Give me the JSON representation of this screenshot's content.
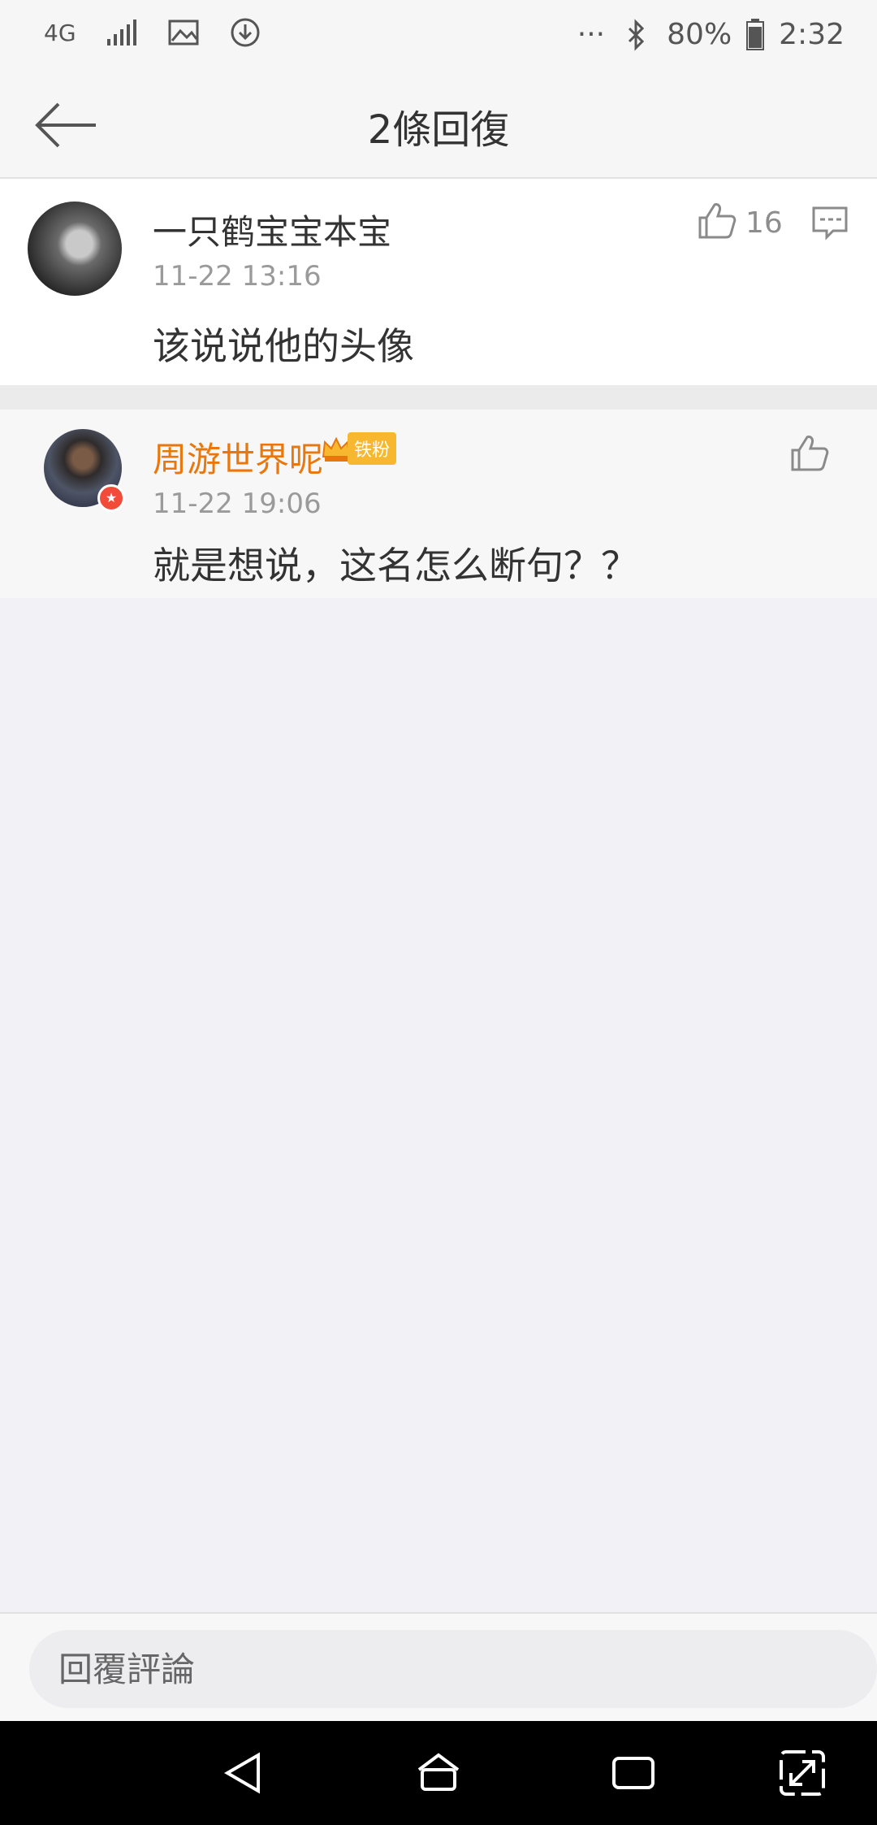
{
  "status_bar": {
    "network": "4G",
    "more": "···",
    "battery": "80%",
    "time": "2:32"
  },
  "header": {
    "title": "2條回復"
  },
  "comments": [
    {
      "user": "一只鹤宝宝本宝",
      "time": "11-22 13:16",
      "text": "该说说他的头像",
      "likes": "16"
    },
    {
      "user": "周游世界呢",
      "badge": "铁粉",
      "time": "11-22 19:06",
      "text": "就是想说，这名怎么断句？？"
    }
  ],
  "reply_input": {
    "placeholder": "回覆評論"
  },
  "colors": {
    "accent_name": "#e8770e",
    "badge_bg": "#f7b82f"
  }
}
